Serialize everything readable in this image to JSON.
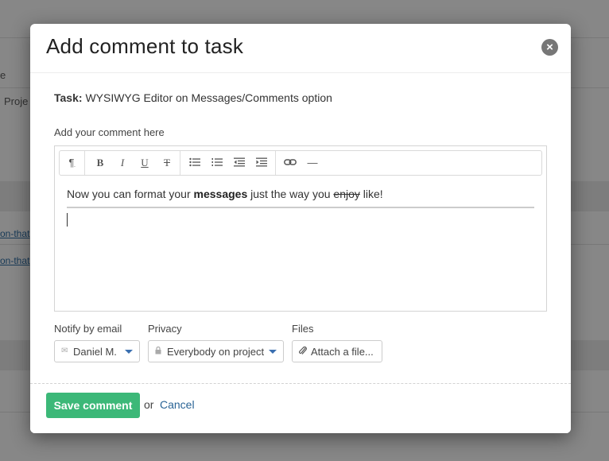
{
  "background": {
    "text_fragment_1": "e",
    "text_fragment_2": "Proje",
    "link_fragment_1": "on-that",
    "link_fragment_2": "on-that"
  },
  "modal": {
    "title": "Add comment to task",
    "close_icon": "close-icon",
    "task": {
      "label": "Task:",
      "value": "WYSIWYG Editor on Messages/Comments option"
    },
    "comment_label": "Add your comment here",
    "toolbar": {
      "buttons": [
        {
          "name": "paragraph-icon",
          "glyph": "¶"
        },
        {
          "name": "bold-icon",
          "glyph": "B"
        },
        {
          "name": "italic-icon",
          "glyph": "I"
        },
        {
          "name": "underline-icon",
          "glyph": "U"
        },
        {
          "name": "strikethrough-icon",
          "glyph": "T"
        },
        {
          "name": "bullet-list-icon"
        },
        {
          "name": "numbered-list-icon"
        },
        {
          "name": "outdent-icon"
        },
        {
          "name": "indent-icon"
        },
        {
          "name": "link-icon"
        },
        {
          "name": "horizontal-rule-icon",
          "glyph": "—"
        }
      ]
    },
    "editor_content": {
      "part1": "Now you can format your ",
      "bold": "messages",
      "part2": " just the way you ",
      "strike": "enjoy",
      "part3": " like!"
    },
    "notify": {
      "label": "Notify by email",
      "value": "Daniel M.",
      "icon": "envelope-icon"
    },
    "privacy": {
      "label": "Privacy",
      "value": "Everybody on project",
      "icon": "lock-icon"
    },
    "files": {
      "label": "Files",
      "button": "Attach a file...",
      "icon": "paperclip-icon"
    },
    "footer": {
      "save": "Save comment",
      "or": "or",
      "cancel": "Cancel"
    },
    "colors": {
      "save_button": "#3cb878",
      "link": "#2a6496",
      "dropdown_caret": "#3a6fb0"
    }
  }
}
